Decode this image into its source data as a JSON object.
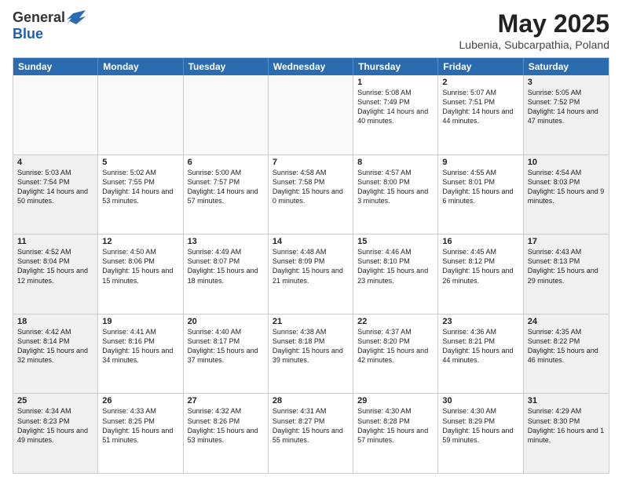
{
  "header": {
    "logo_general": "General",
    "logo_blue": "Blue",
    "month_title": "May 2025",
    "subtitle": "Lubenia, Subcarpathia, Poland"
  },
  "day_headers": [
    "Sunday",
    "Monday",
    "Tuesday",
    "Wednesday",
    "Thursday",
    "Friday",
    "Saturday"
  ],
  "weeks": [
    {
      "days": [
        {
          "num": "",
          "info": "",
          "empty": true
        },
        {
          "num": "",
          "info": "",
          "empty": true
        },
        {
          "num": "",
          "info": "",
          "empty": true
        },
        {
          "num": "",
          "info": "",
          "empty": true
        },
        {
          "num": "1",
          "info": "Sunrise: 5:08 AM\nSunset: 7:49 PM\nDaylight: 14 hours\nand 40 minutes."
        },
        {
          "num": "2",
          "info": "Sunrise: 5:07 AM\nSunset: 7:51 PM\nDaylight: 14 hours\nand 44 minutes."
        },
        {
          "num": "3",
          "info": "Sunrise: 5:05 AM\nSunset: 7:52 PM\nDaylight: 14 hours\nand 47 minutes.",
          "shade": true
        }
      ]
    },
    {
      "days": [
        {
          "num": "4",
          "info": "Sunrise: 5:03 AM\nSunset: 7:54 PM\nDaylight: 14 hours\nand 50 minutes.",
          "shade": true
        },
        {
          "num": "5",
          "info": "Sunrise: 5:02 AM\nSunset: 7:55 PM\nDaylight: 14 hours\nand 53 minutes."
        },
        {
          "num": "6",
          "info": "Sunrise: 5:00 AM\nSunset: 7:57 PM\nDaylight: 14 hours\nand 57 minutes."
        },
        {
          "num": "7",
          "info": "Sunrise: 4:58 AM\nSunset: 7:58 PM\nDaylight: 15 hours\nand 0 minutes."
        },
        {
          "num": "8",
          "info": "Sunrise: 4:57 AM\nSunset: 8:00 PM\nDaylight: 15 hours\nand 3 minutes."
        },
        {
          "num": "9",
          "info": "Sunrise: 4:55 AM\nSunset: 8:01 PM\nDaylight: 15 hours\nand 6 minutes."
        },
        {
          "num": "10",
          "info": "Sunrise: 4:54 AM\nSunset: 8:03 PM\nDaylight: 15 hours\nand 9 minutes.",
          "shade": true
        }
      ]
    },
    {
      "days": [
        {
          "num": "11",
          "info": "Sunrise: 4:52 AM\nSunset: 8:04 PM\nDaylight: 15 hours\nand 12 minutes.",
          "shade": true
        },
        {
          "num": "12",
          "info": "Sunrise: 4:50 AM\nSunset: 8:06 PM\nDaylight: 15 hours\nand 15 minutes."
        },
        {
          "num": "13",
          "info": "Sunrise: 4:49 AM\nSunset: 8:07 PM\nDaylight: 15 hours\nand 18 minutes."
        },
        {
          "num": "14",
          "info": "Sunrise: 4:48 AM\nSunset: 8:09 PM\nDaylight: 15 hours\nand 21 minutes."
        },
        {
          "num": "15",
          "info": "Sunrise: 4:46 AM\nSunset: 8:10 PM\nDaylight: 15 hours\nand 23 minutes."
        },
        {
          "num": "16",
          "info": "Sunrise: 4:45 AM\nSunset: 8:12 PM\nDaylight: 15 hours\nand 26 minutes."
        },
        {
          "num": "17",
          "info": "Sunrise: 4:43 AM\nSunset: 8:13 PM\nDaylight: 15 hours\nand 29 minutes.",
          "shade": true
        }
      ]
    },
    {
      "days": [
        {
          "num": "18",
          "info": "Sunrise: 4:42 AM\nSunset: 8:14 PM\nDaylight: 15 hours\nand 32 minutes.",
          "shade": true
        },
        {
          "num": "19",
          "info": "Sunrise: 4:41 AM\nSunset: 8:16 PM\nDaylight: 15 hours\nand 34 minutes."
        },
        {
          "num": "20",
          "info": "Sunrise: 4:40 AM\nSunset: 8:17 PM\nDaylight: 15 hours\nand 37 minutes."
        },
        {
          "num": "21",
          "info": "Sunrise: 4:38 AM\nSunset: 8:18 PM\nDaylight: 15 hours\nand 39 minutes."
        },
        {
          "num": "22",
          "info": "Sunrise: 4:37 AM\nSunset: 8:20 PM\nDaylight: 15 hours\nand 42 minutes."
        },
        {
          "num": "23",
          "info": "Sunrise: 4:36 AM\nSunset: 8:21 PM\nDaylight: 15 hours\nand 44 minutes."
        },
        {
          "num": "24",
          "info": "Sunrise: 4:35 AM\nSunset: 8:22 PM\nDaylight: 15 hours\nand 46 minutes.",
          "shade": true
        }
      ]
    },
    {
      "days": [
        {
          "num": "25",
          "info": "Sunrise: 4:34 AM\nSunset: 8:23 PM\nDaylight: 15 hours\nand 49 minutes.",
          "shade": true
        },
        {
          "num": "26",
          "info": "Sunrise: 4:33 AM\nSunset: 8:25 PM\nDaylight: 15 hours\nand 51 minutes."
        },
        {
          "num": "27",
          "info": "Sunrise: 4:32 AM\nSunset: 8:26 PM\nDaylight: 15 hours\nand 53 minutes."
        },
        {
          "num": "28",
          "info": "Sunrise: 4:31 AM\nSunset: 8:27 PM\nDaylight: 15 hours\nand 55 minutes."
        },
        {
          "num": "29",
          "info": "Sunrise: 4:30 AM\nSunset: 8:28 PM\nDaylight: 15 hours\nand 57 minutes."
        },
        {
          "num": "30",
          "info": "Sunrise: 4:30 AM\nSunset: 8:29 PM\nDaylight: 15 hours\nand 59 minutes."
        },
        {
          "num": "31",
          "info": "Sunrise: 4:29 AM\nSunset: 8:30 PM\nDaylight: 16 hours\nand 1 minute.",
          "shade": true
        }
      ]
    }
  ]
}
